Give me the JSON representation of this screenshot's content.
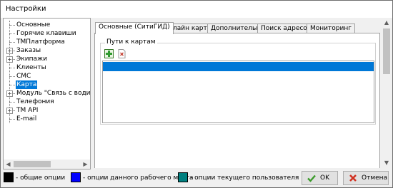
{
  "window": {
    "title": "Настройки"
  },
  "tree": {
    "items": [
      {
        "label": "Основные",
        "expandable": false,
        "selected": false
      },
      {
        "label": "Горячие клавиши",
        "expandable": false,
        "selected": false
      },
      {
        "label": "ТМПлатформа",
        "expandable": false,
        "selected": false
      },
      {
        "label": "Заказы",
        "expandable": true,
        "selected": false
      },
      {
        "label": "Экипажи",
        "expandable": true,
        "selected": false
      },
      {
        "label": "Клиенты",
        "expandable": false,
        "selected": false
      },
      {
        "label": "СМС",
        "expandable": false,
        "selected": false
      },
      {
        "label": "Карта",
        "expandable": false,
        "selected": true
      },
      {
        "label": "Модуль \"Связь с водителе",
        "expandable": true,
        "selected": false
      },
      {
        "label": "Телефония",
        "expandable": false,
        "selected": false
      },
      {
        "label": "TM API",
        "expandable": true,
        "selected": false
      },
      {
        "label": "E-mail",
        "expandable": false,
        "selected": false
      }
    ]
  },
  "tabs": [
    {
      "label": "Основные (СитиГИД)",
      "active": true
    },
    {
      "label": "Онлайн карты",
      "active": false
    },
    {
      "label": "Дополнительно",
      "active": false
    },
    {
      "label": "Поиск адресов",
      "active": false
    },
    {
      "label": "Мониторинг",
      "active": false
    }
  ],
  "group": {
    "title": "Пути к картам",
    "toolbar": [
      {
        "icon": "add-icon"
      },
      {
        "icon": "delete-icon"
      }
    ],
    "list_rows": [
      {
        "text": "",
        "selected": true
      }
    ]
  },
  "legend": [
    {
      "color": "#000000",
      "text": "- общие опции"
    },
    {
      "color": "#0000ff",
      "text": "- опции данного рабочего места"
    },
    {
      "color": "#008080",
      "text": "- опции текущего пользователя"
    }
  ],
  "buttons": {
    "ok": {
      "label": "OK",
      "icon": "checkmark-icon"
    },
    "cancel": {
      "label": "Отмена",
      "icon": "cross-icon"
    }
  }
}
